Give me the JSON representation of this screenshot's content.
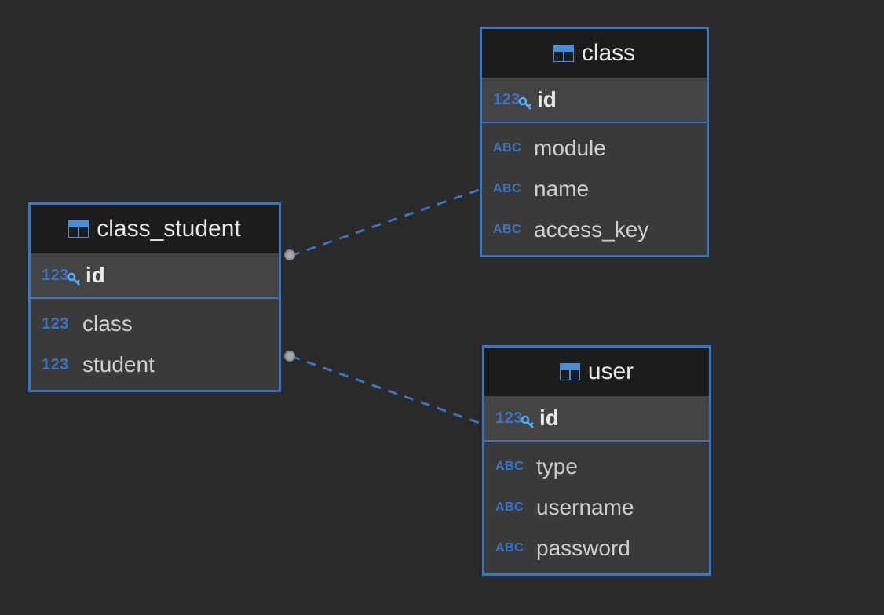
{
  "colors": {
    "border": "#3b74c5",
    "bg": "#2a2a2a",
    "header_bg": "#1c1c1c",
    "box_bg": "#3a3a3a",
    "pk_bg": "#444444",
    "text": "#e8e8e8",
    "col_text": "#cfcfcf",
    "line": "#3b74c5"
  },
  "tables": {
    "class_student": {
      "name": "class_student",
      "columns": [
        {
          "name": "id",
          "type": "123",
          "pk": true
        },
        {
          "name": "class",
          "type": "123",
          "pk": false
        },
        {
          "name": "student",
          "type": "123",
          "pk": false
        }
      ]
    },
    "class": {
      "name": "class",
      "columns": [
        {
          "name": "id",
          "type": "123",
          "pk": true
        },
        {
          "name": "module",
          "type": "ABC",
          "pk": false
        },
        {
          "name": "name",
          "type": "ABC",
          "pk": false
        },
        {
          "name": "access_key",
          "type": "ABC",
          "pk": false
        }
      ]
    },
    "user": {
      "name": "user",
      "columns": [
        {
          "name": "id",
          "type": "123",
          "pk": true
        },
        {
          "name": "type",
          "type": "ABC",
          "pk": false
        },
        {
          "name": "username",
          "type": "ABC",
          "pk": false
        },
        {
          "name": "password",
          "type": "ABC",
          "pk": false
        }
      ]
    }
  },
  "relationships": [
    {
      "from": "class_student.class",
      "to": "class.id"
    },
    {
      "from": "class_student.student",
      "to": "user.id"
    }
  ]
}
